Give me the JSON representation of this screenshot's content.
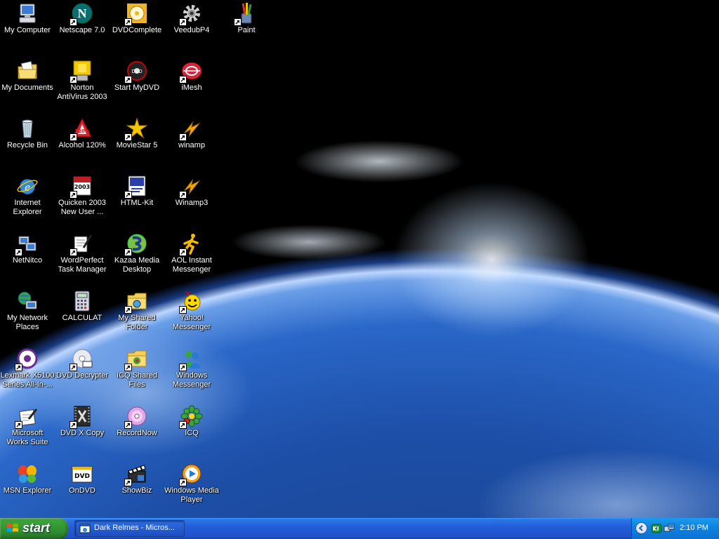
{
  "desktop": {
    "icons": [
      {
        "label": "My Computer"
      },
      {
        "label": "Netscape 7.0"
      },
      {
        "label": "DVDComplete"
      },
      {
        "label": "VeedubP4"
      },
      {
        "label": "Paint"
      },
      {
        "label": "My Documents"
      },
      {
        "label": "Norton AntiVirus 2003"
      },
      {
        "label": "Start MyDVD"
      },
      {
        "label": "iMesh"
      },
      {
        "label": "Recycle Bin"
      },
      {
        "label": "Alcohol 120%"
      },
      {
        "label": "MovieStar 5"
      },
      {
        "label": "winamp"
      },
      {
        "label": "Internet Explorer"
      },
      {
        "label": "Quicken 2003 New User ..."
      },
      {
        "label": "HTML-Kit"
      },
      {
        "label": "Winamp3"
      },
      {
        "label": "NetNitco"
      },
      {
        "label": "WordPerfect Task Manager"
      },
      {
        "label": "Kazaa Media Desktop"
      },
      {
        "label": "AOL Instant Messenger"
      },
      {
        "label": "My Network Places"
      },
      {
        "label": "CALCULAT"
      },
      {
        "label": "My Shared Folder"
      },
      {
        "label": "Yahoo! Messenger"
      },
      {
        "label": "Lexmark X5100 Series All-In-..."
      },
      {
        "label": "DVD Decrypter"
      },
      {
        "label": "ICQ Shared Files"
      },
      {
        "label": "Windows Messenger"
      },
      {
        "label": "Microsoft Works Suite"
      },
      {
        "label": "DVD X Copy"
      },
      {
        "label": "RecordNow"
      },
      {
        "label": "ICQ"
      },
      {
        "label": "MSN Explorer"
      },
      {
        "label": "OnDVD"
      },
      {
        "label": "ShowBiz"
      },
      {
        "label": "Windows Media Player"
      }
    ]
  },
  "taskbar": {
    "start_label": "start",
    "task_label": "Dark Relmes - Micros...",
    "clock": "2:10 PM"
  }
}
